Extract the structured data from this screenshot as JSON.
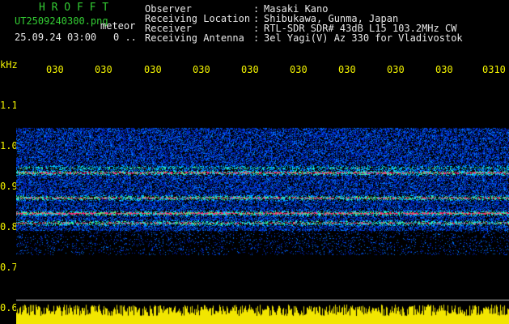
{
  "header": {
    "logo": "H R O F F T",
    "filename": "UT2509240300.png",
    "file_suffix": "meteor",
    "datetime": "25.09.24 03:00",
    "count": "0 ..",
    "info": [
      {
        "label": "Observer",
        "value": "Masaki Kano"
      },
      {
        "label": "Receiving Location",
        "value": "Shibukawa, Gunma, Japan"
      },
      {
        "label": "Receiver",
        "value": "RTL-SDR SDR# 43dB L15 103.2MHz CW"
      },
      {
        "label": "Receiving Antenna",
        "value": "3el Yagi(V) Az 330 for Vladivostok"
      }
    ]
  },
  "axes": {
    "y_unit": "kHz",
    "y_ticks": [
      "1.1",
      "1.0",
      "0.9",
      "0.8",
      "0.7",
      "0.6"
    ],
    "x_ticks": [
      "030",
      "030",
      "030",
      "030",
      "030",
      "030",
      "030",
      "030",
      "030",
      "0310"
    ]
  },
  "colors": {
    "text_white": "#e8e8e8",
    "logo_green": "#33cc33",
    "axis_yellow": "#f2f200",
    "background": "#000000"
  }
}
